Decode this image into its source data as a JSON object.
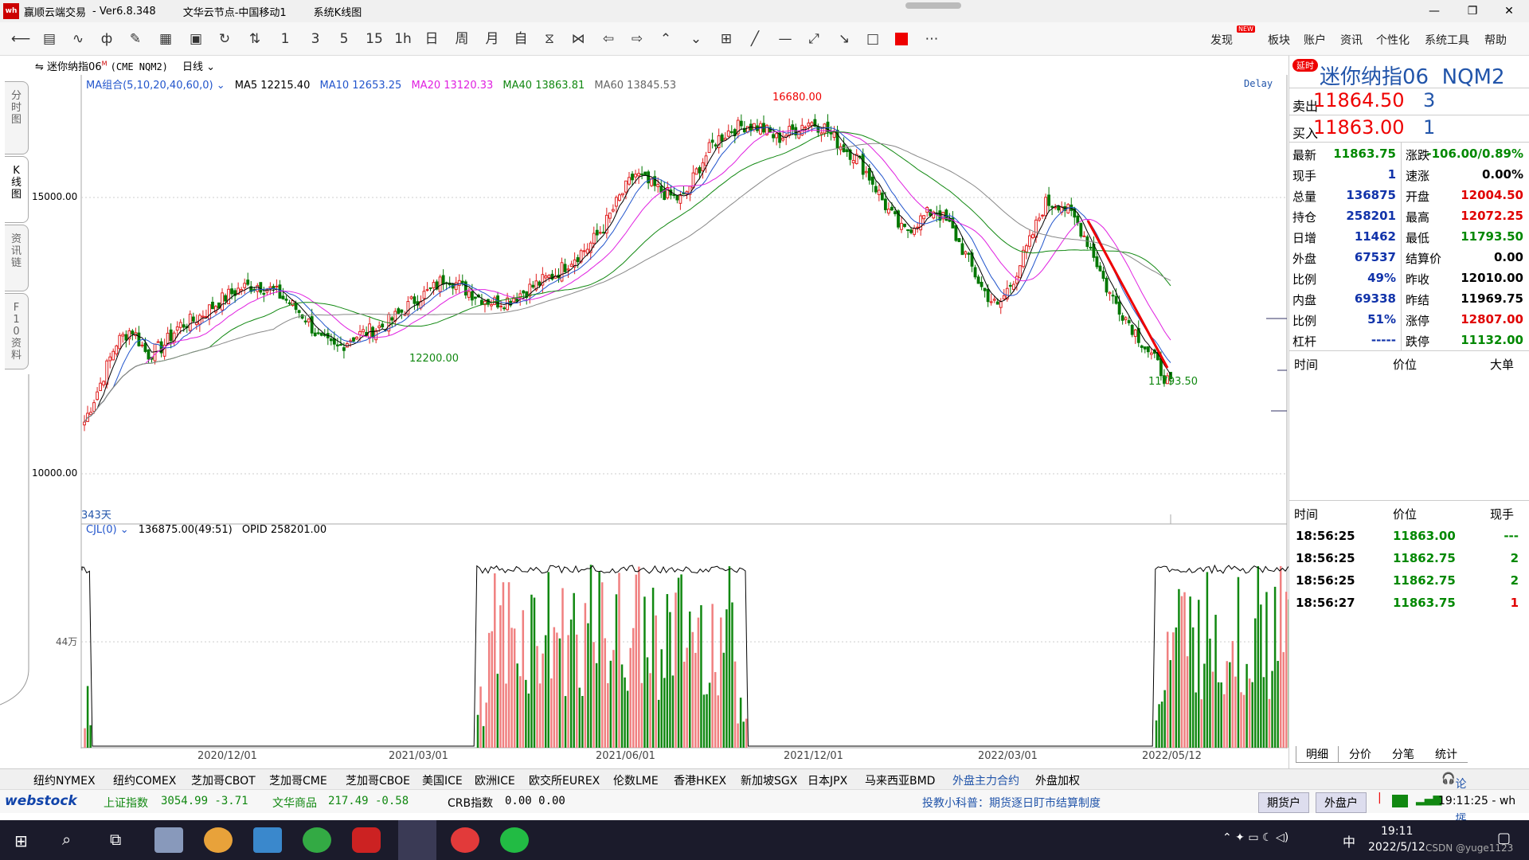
{
  "window": {
    "app_name": "赢顺云端交易",
    "version": "Ver6.8.348",
    "node": "文华云节点-中国移动1",
    "view": "系统K线图"
  },
  "toolbar": {
    "left_icons": [
      "back-icon",
      "list-icon",
      "line-chart-icon",
      "kline-icon",
      "draw-icon",
      "calc-icon",
      "save-icon",
      "refresh-icon",
      "compare-icon"
    ],
    "periods": [
      "1",
      "3",
      "5",
      "15",
      "1h",
      "日",
      "周",
      "月",
      "自"
    ],
    "right_menu": [
      "发现",
      "板块",
      "账户",
      "资讯",
      "个性化",
      "系统工具",
      "帮助"
    ],
    "new_badge": "NEW"
  },
  "chart_header": {
    "symbol": "迷你纳指06",
    "exchange_code": "(CME NQM2)",
    "period": "日线",
    "ma_group": "MA组合(5,10,20,40,60,0)",
    "ma5": "MA5 12215.40",
    "ma10": "MA10 12653.25",
    "ma20": "MA20 13120.33",
    "ma40": "MA40 13863.81",
    "ma60": "MA60 13845.53",
    "delay": "Delay",
    "high_label": "16680.00",
    "mid_low_label": "12200.00",
    "last_low_label": "11793.50",
    "days": "343天",
    "y_labels": [
      "15000.00",
      "10000.00"
    ],
    "vol_header": "CJL(0)",
    "vol_value": "136875.00(49:51)",
    "opid": "OPID 258201.00",
    "vol_y_label": "44万",
    "x_labels": [
      "2020/12/01",
      "2021/03/01",
      "2021/06/01",
      "2021/12/01",
      "2022/03/01",
      "2022/05/12"
    ]
  },
  "side_tabs": [
    "分时图",
    "K线图",
    "资讯链",
    "F10资料"
  ],
  "quote": {
    "badge": "延时",
    "name": "迷你纳指06",
    "code": "NQM2",
    "sell_label": "卖出",
    "sell_price": "11864.50",
    "sell_qty": "3",
    "buy_label": "买入",
    "buy_price": "11863.00",
    "buy_qty": "1",
    "left_rows": [
      {
        "label": "最新",
        "value": "11863.75",
        "color": "green"
      },
      {
        "label": "现手",
        "value": "1",
        "color": "blue"
      },
      {
        "label": "总量",
        "value": "136875",
        "color": "blue"
      },
      {
        "label": "持仓",
        "value": "258201",
        "color": "blue"
      },
      {
        "label": "日增",
        "value": "11462",
        "color": "blue"
      },
      {
        "label": "外盘",
        "value": "67537",
        "color": "blue"
      },
      {
        "label": "比例",
        "value": "49%",
        "color": "blue"
      },
      {
        "label": "内盘",
        "value": "69338",
        "color": "blue"
      },
      {
        "label": "比例",
        "value": "51%",
        "color": "blue"
      },
      {
        "label": "杠杆",
        "value": "-----",
        "color": "blue"
      }
    ],
    "right_rows": [
      {
        "label": "涨跌",
        "value": "-106.00/0.89%",
        "color": "green"
      },
      {
        "label": "速涨",
        "value": "0.00%",
        "color": "black"
      },
      {
        "label": "开盘",
        "value": "12004.50",
        "color": "red"
      },
      {
        "label": "最高",
        "value": "12072.25",
        "color": "red"
      },
      {
        "label": "最低",
        "value": "11793.50",
        "color": "green"
      },
      {
        "label": "结算价",
        "value": "0.00",
        "color": "black"
      },
      {
        "label": "昨收",
        "value": "12010.00",
        "color": "black"
      },
      {
        "label": "昨结",
        "value": "11969.75",
        "color": "black"
      },
      {
        "label": "涨停",
        "value": "12807.00",
        "color": "red"
      },
      {
        "label": "跌停",
        "value": "11132.00",
        "color": "green"
      }
    ],
    "big_header": {
      "time": "时间",
      "price": "价位",
      "big": "大单"
    },
    "tick_header": {
      "time": "时间",
      "price": "价位",
      "qty": "现手"
    },
    "ticks": [
      {
        "time": "18:56:25",
        "price": "11863.00",
        "qty": "---",
        "qcolor": "green"
      },
      {
        "time": "18:56:25",
        "price": "11862.75",
        "qty": "2",
        "qcolor": "green"
      },
      {
        "time": "18:56:25",
        "price": "11862.75",
        "qty": "2",
        "qcolor": "green"
      },
      {
        "time": "18:56:27",
        "price": "11863.75",
        "qty": "1",
        "qcolor": "red"
      }
    ],
    "bottom_tabs": [
      "明细",
      "分价",
      "分笔",
      "统计"
    ]
  },
  "exchange_bar": [
    "纽约NYMEX",
    "纽约COMEX",
    "芝加哥CBOT",
    "芝加哥CME",
    "芝加哥CBOE",
    "美国ICE",
    "欧洲ICE",
    "欧交所EUREX",
    "伦数LME",
    "香港HKEX",
    "新加坡SGX",
    "日本JPX",
    "马来西亚BMD",
    "外盘主力合约",
    "外盘加权"
  ],
  "exchange_active": "外盘主力合约",
  "forum_link": "论坛提问",
  "status": {
    "brand": "webstock",
    "idx1_name": "上证指数",
    "idx1_val": "3054.99 -3.71",
    "idx2_name": "文华商品",
    "idx2_val": "217.49 -0.58",
    "idx3_name": "CRB指数",
    "idx3_val": "0.00 0.00",
    "tip": "投教小科普：期货逐日盯市结算制度",
    "btn1": "期货户",
    "btn2": "外盘户",
    "clock": "19:11:25 - wh"
  },
  "taskbar": {
    "ime": "中",
    "time": "19:11",
    "date": "2022/5/12",
    "watermark": "CSDN @yuge1123"
  },
  "chart_data": {
    "type": "candlestick",
    "title": "迷你纳指06 (CME NQM2) 日线",
    "ylim": [
      9500,
      17200
    ],
    "x_ticks": [
      "2020/12/01",
      "2021/03/01",
      "2021/06/01",
      "2021/12/01",
      "2022/03/01",
      "2022/05/12"
    ],
    "close_path": [
      11250,
      11900,
      12600,
      12850,
      12400,
      12550,
      12900,
      13000,
      13200,
      13400,
      13550,
      13600,
      13500,
      13300,
      13050,
      12650,
      12500,
      12700,
      12800,
      12900,
      13100,
      13350,
      13500,
      13750,
      13550,
      13400,
      13300,
      13350,
      13500,
      13650,
      13800,
      14050,
      14250,
      14600,
      15100,
      15500,
      15300,
      15150,
      15050,
      15600,
      16050,
      16250,
      16350,
      16300,
      16100,
      16250,
      16400,
      16300,
      16000,
      15800,
      15400,
      14900,
      14500,
      14700,
      14900,
      14600,
      14100,
      13550,
      13200,
      13700,
      14300,
      15000,
      15000,
      14700,
      14200,
      13500,
      13100,
      12700,
      12300,
      11863
    ],
    "annotations": {
      "high": 16680.0,
      "low_2021": 12200.0,
      "low_2022": 11793.5
    }
  }
}
